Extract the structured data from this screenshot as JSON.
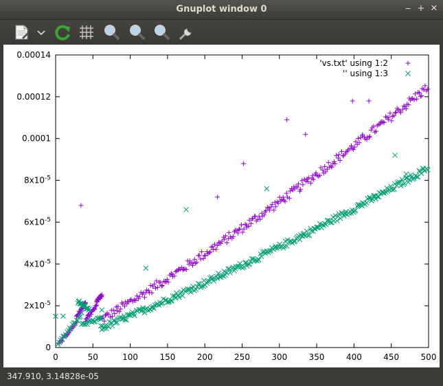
{
  "window": {
    "title": "Gnuplot window 0"
  },
  "toolbar": {
    "icons": [
      "copy-to-clipboard-icon",
      "dropdown-chevron-icon",
      "replot-icon",
      "grid-icon",
      "zoom-prev-icon",
      "zoom-next-icon",
      "zoom-autoscale-icon",
      "configure-icon"
    ]
  },
  "status": {
    "text": "347.910,  3.14828e-05"
  },
  "chart_data": {
    "type": "scatter",
    "title": "",
    "xlabel": "",
    "ylabel": "",
    "xlim": [
      0,
      500
    ],
    "ylim": [
      0,
      0.00014
    ],
    "grid": false,
    "legend_position": "top-right",
    "x_ticks": [
      "0",
      "50",
      "100",
      "150",
      "200",
      "250",
      "300",
      "350",
      "400",
      "450",
      "500"
    ],
    "y_ticks": [
      "0",
      "2x10-5",
      "4x10-5",
      "6x10-5",
      "8x10-5",
      "0.0001",
      "0.00012",
      "0.00014"
    ],
    "y_tick_values": [
      0,
      2e-05,
      4e-05,
      6e-05,
      8e-05,
      0.0001,
      0.00012,
      0.00014
    ],
    "x_tick_values": [
      0,
      50,
      100,
      150,
      200,
      250,
      300,
      350,
      400,
      450,
      500
    ],
    "series": [
      {
        "name": "'vs.txt' using 1:2",
        "color": "#9400d3",
        "marker": "+",
        "trend": {
          "x_start": 0,
          "x_end": 500,
          "y_start": 5e-07,
          "y_end": 0.000125,
          "shape": "slightly-convex"
        },
        "early_segments": [
          {
            "x": [
              5,
              28
            ],
            "y": [
              2e-06,
              1.2e-05
            ]
          },
          {
            "x": [
              28,
              40
            ],
            "y": [
              1.5e-05,
              2.1e-05
            ]
          },
          {
            "x": [
              40,
              55
            ],
            "y": [
              1.3e-05,
              2e-05
            ]
          },
          {
            "x": [
              55,
              62
            ],
            "y": [
              2.2e-05,
              2.5e-05
            ]
          }
        ],
        "outliers": [
          {
            "x": 34,
            "y": 6.8e-05
          },
          {
            "x": 217,
            "y": 7.2e-05
          },
          {
            "x": 252,
            "y": 8.8e-05
          },
          {
            "x": 310,
            "y": 0.000109
          },
          {
            "x": 335,
            "y": 0.000102
          },
          {
            "x": 398,
            "y": 0.000118
          },
          {
            "x": 420,
            "y": 0.000118
          }
        ]
      },
      {
        "name": "'' using 1:3",
        "color": "#009e73",
        "marker": "x",
        "trend": {
          "x_start": 0,
          "x_end": 500,
          "y_start": 5e-07,
          "y_end": 8.6e-05,
          "shape": "slightly-convex"
        },
        "early_segments": [
          {
            "x": [
              3,
              35
            ],
            "y": [
              2e-06,
              1.6e-05
            ]
          },
          {
            "x": [
              30,
              45
            ],
            "y": [
              2.2e-05,
              1.8e-05
            ]
          },
          {
            "x": [
              35,
              62
            ],
            "y": [
              1.1e-05,
              1.4e-05
            ]
          }
        ],
        "outliers": [
          {
            "x": 0,
            "y": 1.5e-05
          },
          {
            "x": 10,
            "y": 1.5e-05
          },
          {
            "x": 62,
            "y": 1.8e-05
          },
          {
            "x": 121,
            "y": 3.8e-05
          },
          {
            "x": 175,
            "y": 6.6e-05
          },
          {
            "x": 283,
            "y": 7.6e-05
          },
          {
            "x": 455,
            "y": 9.2e-05
          },
          {
            "x": 470,
            "y": 8.3e-05
          }
        ]
      }
    ]
  }
}
